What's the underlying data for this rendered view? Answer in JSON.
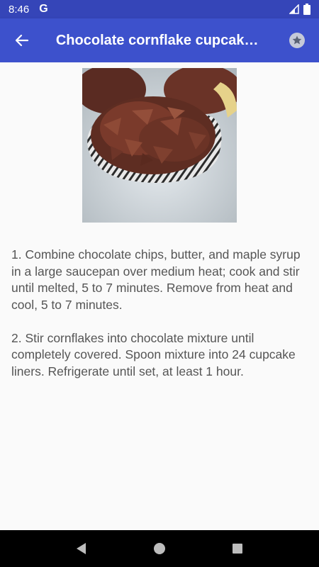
{
  "status_bar": {
    "time": "8:46",
    "notification_icon": "google-g-icon"
  },
  "app_bar": {
    "back_icon": "arrow-back-icon",
    "title": "Chocolate cornflake cupcak…",
    "favorite_icon": "star-icon"
  },
  "recipe": {
    "image_icon": "chocolate-cornflake-cupcakes-photo",
    "steps": [
      "1. Combine chocolate chips, butter, and maple syrup in a large saucepan over medium heat; cook and stir until melted, 5 to 7 minutes. Remove from heat and cool, 5 to 7 minutes.",
      "2. Stir cornflakes into chocolate mixture until completely covered. Spoon mixture into 24 cupcake liners. Refrigerate until set, at least 1 hour."
    ]
  },
  "nav_bar": {
    "back_icon": "nav-back-icon",
    "home_icon": "nav-home-icon",
    "recents_icon": "nav-recents-icon"
  },
  "colors": {
    "app_bar": "#3d51cc",
    "status_bar": "#3545b8",
    "body_text": "#555555"
  }
}
